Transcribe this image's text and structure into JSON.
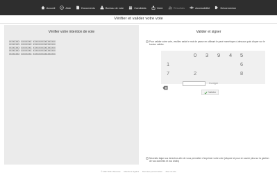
{
  "nav": {
    "items": [
      {
        "label": "Accueil",
        "icon": "home-icon"
      },
      {
        "label": "Aide",
        "icon": "help-icon"
      },
      {
        "label": "Documents",
        "icon": "document-icon"
      },
      {
        "label": "Bureau de vote",
        "icon": "ballot-box-icon"
      },
      {
        "label": "Candidats",
        "icon": "candidates-icon"
      },
      {
        "label": "Voter",
        "icon": "vote-icon"
      },
      {
        "label": "Résultats",
        "icon": "results-icon",
        "disabled": true
      },
      {
        "label": "Accessibilité",
        "icon": "accessibility-icon"
      },
      {
        "label": "Déconnexion",
        "icon": "logout-icon"
      }
    ]
  },
  "page": {
    "title": "Vérifier et valider votre vote"
  },
  "left": {
    "heading": "Vérifier votre intention de vote",
    "lines": [
      "XXXXXXXX XXXXXXXX XXXXXXXXXXXXXXXXX",
      "XXXXXXXX XXXXXXXX XXXXXXXXXXXXXXXXX",
      "XXXXXXXX XXXXXXXX XXXXXXXXXXXXXXXXX",
      "XXXXXXXX XXXXXXXX XXXXXXXXXXXXXXXXX",
      "XXXXXXXX XXXXXXXX XXXXXXXXXXXXXXXXX"
    ]
  },
  "right": {
    "heading": "Valider et signer",
    "instructions": "Pour valider votre vote, veuillez saisir le mot de passe en utilisant le pavé numérique ci-dessous puis cliquer sur le bouton valider.",
    "keypad": {
      "keys": [
        "0",
        "3",
        "9",
        "4",
        "5",
        "1",
        "6",
        "7",
        "2",
        "8"
      ]
    },
    "corriger": "Corriger",
    "valider": "Valider",
    "notice": "Necesito bajar sus derechos afin de vous permettre d'exprimer votre vote (cliquez ici pour en savoir plus sur la gestion de vos données et vos droits)"
  },
  "footer": {
    "copyright": "© 2007-2014 Neovote",
    "links": [
      "Mentions légales",
      "Données personnelles",
      "Plan du site"
    ]
  },
  "colors": {
    "topbar": "#2e2e2e",
    "panel": "#ebebeb",
    "keypad": "#f0f0f0"
  }
}
